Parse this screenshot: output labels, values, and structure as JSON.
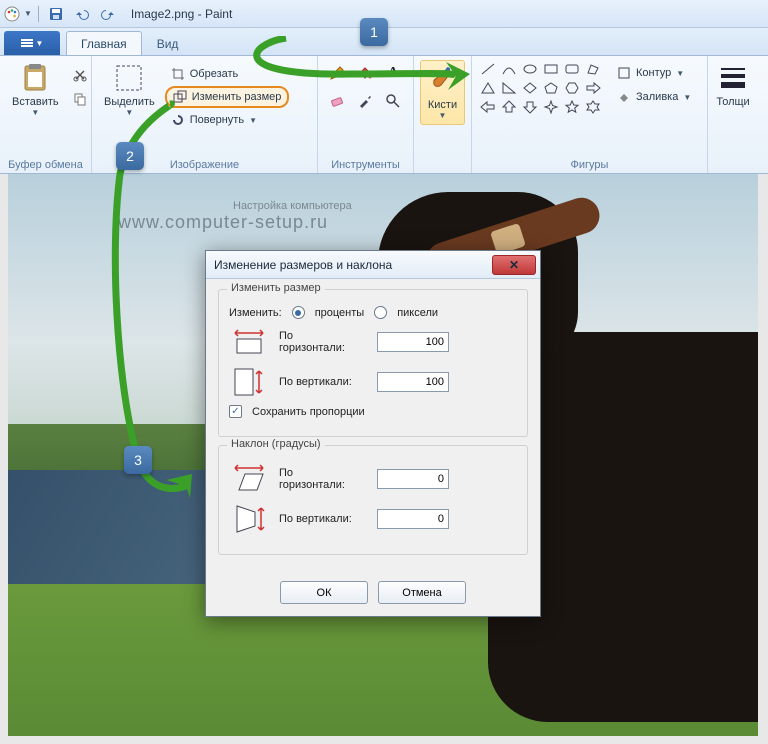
{
  "window": {
    "title": "Image2.png - Paint"
  },
  "tabs": {
    "home": "Главная",
    "view": "Вид"
  },
  "ribbon": {
    "clipboard": {
      "paste": "Вставить",
      "group": "Буфер обмена"
    },
    "image": {
      "select": "Выделить",
      "crop": "Обрезать",
      "resize": "Изменить размер",
      "rotate": "Повернуть",
      "group": "Изображение"
    },
    "tools": {
      "group": "Инструменты"
    },
    "brushes": {
      "label": "Кисти"
    },
    "shapes": {
      "outline": "Контур",
      "fill": "Заливка",
      "group": "Фигуры"
    },
    "size": {
      "label": "Толщи"
    }
  },
  "watermark": {
    "top": "Настройка компьютера",
    "url": "www.computer-setup.ru"
  },
  "dialog": {
    "title": "Изменение размеров и наклона",
    "resize": {
      "legend": "Изменить размер",
      "by": "Изменить:",
      "percent": "проценты",
      "pixels": "пиксели",
      "horiz": "По\nгоризонтали:",
      "vert": "По вертикали:",
      "h_val": "100",
      "v_val": "100",
      "keep": "Сохранить пропорции"
    },
    "skew": {
      "legend": "Наклон (градусы)",
      "horiz": "По\nгоризонтали:",
      "vert": "По вертикали:",
      "h_val": "0",
      "v_val": "0"
    },
    "ok": "ОК",
    "cancel": "Отмена"
  },
  "annotations": {
    "n1": "1",
    "n2": "2",
    "n3": "3"
  }
}
